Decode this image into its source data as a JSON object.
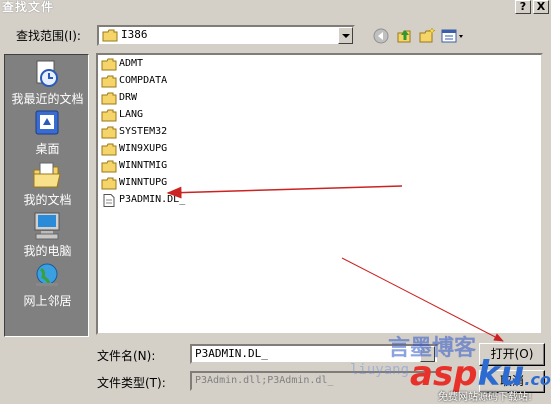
{
  "window": {
    "title": "查找文件",
    "help": "?",
    "close": "X"
  },
  "lookin": {
    "label": "查找范围(I):",
    "value": "I386"
  },
  "places": [
    {
      "label": "我最近的文档",
      "icon": "recent-documents-icon"
    },
    {
      "label": "桌面",
      "icon": "desktop-icon"
    },
    {
      "label": "我的文档",
      "icon": "my-documents-icon"
    },
    {
      "label": "我的电脑",
      "icon": "my-computer-icon"
    },
    {
      "label": "网上邻居",
      "icon": "network-places-icon"
    }
  ],
  "files": [
    {
      "name": "ADMT",
      "type": "folder"
    },
    {
      "name": "COMPDATA",
      "type": "folder"
    },
    {
      "name": "DRW",
      "type": "folder"
    },
    {
      "name": "LANG",
      "type": "folder"
    },
    {
      "name": "SYSTEM32",
      "type": "folder"
    },
    {
      "name": "WIN9XUPG",
      "type": "folder"
    },
    {
      "name": "WINNTMIG",
      "type": "folder"
    },
    {
      "name": "WINNTUPG",
      "type": "folder"
    },
    {
      "name": "P3ADMIN.DL_",
      "type": "file"
    }
  ],
  "filename": {
    "label": "文件名(N):",
    "value": "P3ADMIN.DL_"
  },
  "filetype": {
    "label": "文件类型(T):",
    "value": "P3Admin.dll;P3Admin.dl_"
  },
  "buttons": {
    "open": "打开(O)",
    "cancel": "取消"
  },
  "watermark": {
    "line1": "言墨博客",
    "line2": "liuyang",
    "brand_a": "asp",
    "brand_b": "ku",
    "brand_c": ".com",
    "tagline": "免费网站源码下载站!"
  },
  "colors": {
    "places_bg": "#808080",
    "dialog_bg": "#d4d0c8",
    "arrow": "#cc2222"
  }
}
